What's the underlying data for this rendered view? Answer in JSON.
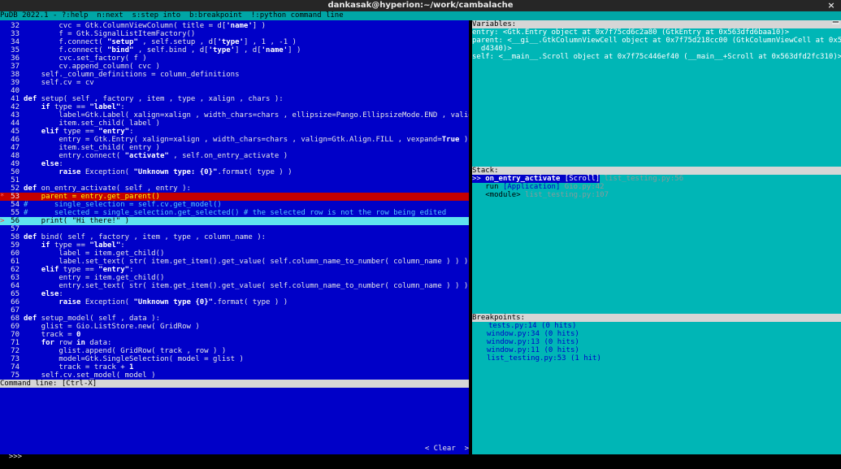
{
  "window": {
    "title": "dankasak@hyperion:~/work/cambalache",
    "close_glyph": "×"
  },
  "menubar": {
    "text": "PuDB 2022.1 - ?:help  n:next  s:step into  b:breakpoint  !:python command line"
  },
  "code_lines": [
    {
      "n": "32",
      "mark": "",
      "state": "",
      "html": "        cvc = Gtk.ColumnViewColumn( title = d[<span class='str'>'name'</span>] )"
    },
    {
      "n": "33",
      "mark": "",
      "state": "",
      "html": "        f = Gtk.SignalListItemFactory()"
    },
    {
      "n": "34",
      "mark": "",
      "state": "",
      "html": "        f.connect( <span class='str'>\"setup\"</span> , self.setup , d[<span class='str'>'type'</span>] , 1 , -1 )"
    },
    {
      "n": "35",
      "mark": "",
      "state": "",
      "html": "        f.connect( <span class='str'>\"bind\"</span> , self.bind , d[<span class='str'>'type'</span>] , d[<span class='str'>'name'</span>] )"
    },
    {
      "n": "36",
      "mark": "",
      "state": "",
      "html": "        cvc.set_factory( f )"
    },
    {
      "n": "37",
      "mark": "",
      "state": "",
      "html": "        cv.append_column( cvc )"
    },
    {
      "n": "38",
      "mark": "",
      "state": "",
      "html": "    self._column_definitions = column_definitions"
    },
    {
      "n": "39",
      "mark": "",
      "state": "",
      "html": "    self.cv = cv"
    },
    {
      "n": "40",
      "mark": "",
      "state": "",
      "html": ""
    },
    {
      "n": "41",
      "mark": "",
      "state": "",
      "html": "<span class='kw'>def</span> setup( self , factory , item , type , xalign , chars ):"
    },
    {
      "n": "42",
      "mark": "",
      "state": "",
      "html": "    <span class='kw'>if</span> type == <span class='str'>\"label\"</span>:"
    },
    {
      "n": "43",
      "mark": "",
      "state": "",
      "html": "        label=Gtk.Label( xalign=xalign , width_chars=chars , ellipsize=Pango.EllipsizeMode.END , valign=Gtk.Align.FILL , vexpand=True )"
    },
    {
      "n": "44",
      "mark": "",
      "state": "",
      "html": "        item.set_child( label )"
    },
    {
      "n": "45",
      "mark": "",
      "state": "",
      "html": "    <span class='kw'>elif</span> type == <span class='str'>\"entry\"</span>:"
    },
    {
      "n": "46",
      "mark": "",
      "state": "",
      "html": "        entry = Gtk.Entry( xalign=xalign , width_chars=chars , valign=Gtk.Align.FILL , vexpand=<span class='kw'>True</span> )"
    },
    {
      "n": "47",
      "mark": "",
      "state": "",
      "html": "        item.set_child( entry )"
    },
    {
      "n": "48",
      "mark": "",
      "state": "",
      "html": "        entry.connect( <span class='str'>\"activate\"</span> , self.on_entry_activate )"
    },
    {
      "n": "49",
      "mark": "",
      "state": "",
      "html": "    <span class='kw'>else</span>:"
    },
    {
      "n": "50",
      "mark": "",
      "state": "",
      "html": "        <span class='kw'>raise</span> Exception( <span class='str'>\"Unknown type: {0}\"</span>.format( type ) )"
    },
    {
      "n": "51",
      "mark": "",
      "state": "",
      "html": ""
    },
    {
      "n": "52",
      "mark": "",
      "state": "",
      "html": "<span class='kw'>def</span> on_entry_activate( self , entry ):"
    },
    {
      "n": "53",
      "mark": "*",
      "state": "bp",
      "html": "    parent = entry.get_parent()"
    },
    {
      "n": "54",
      "mark": "",
      "state": "cmt",
      "html": "<span class='cmt'>#      single_selection = self.cv.get_model()</span>"
    },
    {
      "n": "55",
      "mark": "",
      "state": "cmt",
      "html": "<span class='cmt'>#      selected = single_selection.get_selected() # the selected row is not the row being edited</span>"
    },
    {
      "n": "56",
      "mark": ">",
      "state": "cur",
      "html": "    print( \"Hi there!\" )"
    },
    {
      "n": "57",
      "mark": "",
      "state": "",
      "html": ""
    },
    {
      "n": "58",
      "mark": "",
      "state": "",
      "html": "<span class='kw'>def</span> bind( self , factory , item , type , column_name ):"
    },
    {
      "n": "59",
      "mark": "",
      "state": "",
      "html": "    <span class='kw'>if</span> type == <span class='str'>\"label\"</span>:"
    },
    {
      "n": "60",
      "mark": "",
      "state": "",
      "html": "        label = item.get_child()"
    },
    {
      "n": "61",
      "mark": "",
      "state": "",
      "html": "        label.set_text( str( item.get_item().get_value( self.column_name_to_number( column_name ) ) ) )"
    },
    {
      "n": "62",
      "mark": "",
      "state": "",
      "html": "    <span class='kw'>elif</span> type == <span class='str'>\"entry\"</span>:"
    },
    {
      "n": "63",
      "mark": "",
      "state": "",
      "html": "        entry = item.get_child()"
    },
    {
      "n": "64",
      "mark": "",
      "state": "",
      "html": "        entry.set_text( str( item.get_item().get_value( self.column_name_to_number( column_name ) ) ) )"
    },
    {
      "n": "65",
      "mark": "",
      "state": "",
      "html": "    <span class='kw'>else</span>:"
    },
    {
      "n": "66",
      "mark": "",
      "state": "",
      "html": "        <span class='kw'>raise</span> Exception( <span class='str'>\"Unknown type {0}\"</span>.format( type ) )"
    },
    {
      "n": "67",
      "mark": "",
      "state": "",
      "html": ""
    },
    {
      "n": "68",
      "mark": "",
      "state": "",
      "html": "<span class='kw'>def</span> setup_model( self , data ):"
    },
    {
      "n": "69",
      "mark": "",
      "state": "",
      "html": "    glist = Gio.ListStore.new( GridRow )"
    },
    {
      "n": "70",
      "mark": "",
      "state": "",
      "html": "    track = <span class='kw'>0</span>"
    },
    {
      "n": "71",
      "mark": "",
      "state": "",
      "html": "    <span class='kw'>for</span> row <span class='kw'>in</span> data:"
    },
    {
      "n": "72",
      "mark": "",
      "state": "",
      "html": "        glist.append( GridRow( track , row ) )"
    },
    {
      "n": "73",
      "mark": "",
      "state": "",
      "html": "        model=Gtk.SingleSelection( model = glist )"
    },
    {
      "n": "74",
      "mark": "",
      "state": "",
      "html": "        track = track + <span class='kw'>1</span>"
    },
    {
      "n": "75",
      "mark": "",
      "state": "",
      "html": "    self.cv.set_model( model )"
    }
  ],
  "command": {
    "header": "Command line: [Ctrl-X]",
    "prompt": ">>>",
    "clear_label": "< Clear  >"
  },
  "variables": {
    "header": "Variables:",
    "controls": "══",
    "rows": [
      "entry: <Gtk.Entry object at 0x7f75cd6c2a80 (GtkEntry at 0x563dfd6baa10)>",
      "parent: <__gi__.GtkColumnViewCell object at 0x7f75d218cc00 (GtkColumnViewCell at 0x563dfd6",
      "  d4340)>",
      "self: <__main__.Scroll object at 0x7f75c446ef40 (__main__+Scroll at 0x563dfd2fc310)>"
    ]
  },
  "stack": {
    "header": "Stack:",
    "frames": [
      {
        "prefix": ">> ",
        "fn": "on_entry_activate",
        "cls": " [Scroll]",
        "loc": " list_testing.py:56",
        "active": true
      },
      {
        "prefix": "   ",
        "fn": "run",
        "cls": " [Application]",
        "loc": " Gio.py:42",
        "active": false
      },
      {
        "prefix": "   ",
        "fn": "<module>",
        "cls": "",
        "loc": " list_testing.py:107",
        "active": false
      }
    ]
  },
  "breakpoints": {
    "header": "Breakpoints:",
    "items": [
      "tests.py:14 (0 hits)",
      "window.py:34 (0 hits)",
      "window.py:13 (0 hits)",
      "window.py:11 (0 hits)",
      "list_testing.py:53 (1 hit)"
    ]
  }
}
